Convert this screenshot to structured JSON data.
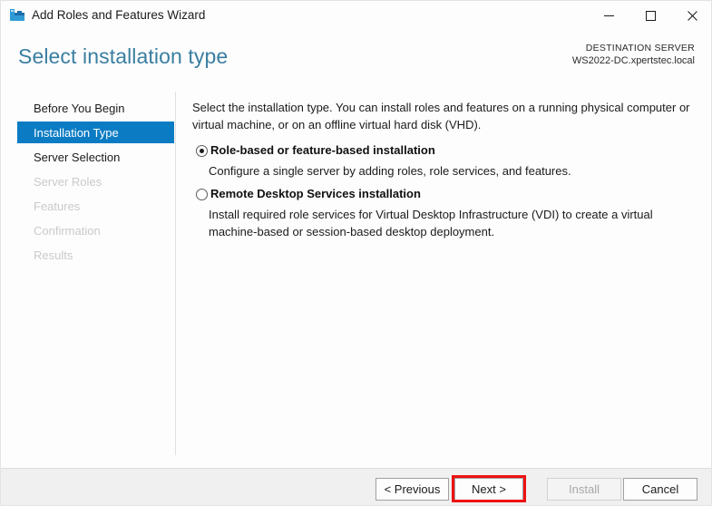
{
  "window": {
    "title": "Add Roles and Features Wizard",
    "app_icon": "server-toolbox-icon",
    "controls": {
      "minimize": "minimize-icon",
      "maximize": "maximize-icon",
      "close": "close-icon"
    }
  },
  "header": {
    "page_title": "Select installation type",
    "destination_label": "DESTINATION SERVER",
    "destination_server": "WS2022-DC.xpertstec.local"
  },
  "nav": {
    "items": [
      {
        "label": "Before You Begin",
        "state": "enabled"
      },
      {
        "label": "Installation Type",
        "state": "selected"
      },
      {
        "label": "Server Selection",
        "state": "enabled"
      },
      {
        "label": "Server Roles",
        "state": "disabled"
      },
      {
        "label": "Features",
        "state": "disabled"
      },
      {
        "label": "Confirmation",
        "state": "disabled"
      },
      {
        "label": "Results",
        "state": "disabled"
      }
    ]
  },
  "main": {
    "intro": "Select the installation type. You can install roles and features on a running physical computer or virtual machine, or on an offline virtual hard disk (VHD).",
    "options": [
      {
        "label": "Role-based or feature-based installation",
        "description": "Configure a single server by adding roles, role services, and features.",
        "selected": true
      },
      {
        "label": "Remote Desktop Services installation",
        "description": "Install required role services for Virtual Desktop Infrastructure (VDI) to create a virtual machine-based or session-based desktop deployment.",
        "selected": false
      }
    ]
  },
  "footer": {
    "previous_label": "< Previous",
    "next_label": "Next >",
    "install_label": "Install",
    "cancel_label": "Cancel",
    "install_disabled": true
  },
  "annotation": {
    "highlight_color": "#ee1111",
    "highlight_target": "next-button"
  },
  "colors": {
    "accent": "#0b7cc4",
    "title_blue": "#3a7ea1",
    "footer_bg": "#f0f0f0"
  }
}
